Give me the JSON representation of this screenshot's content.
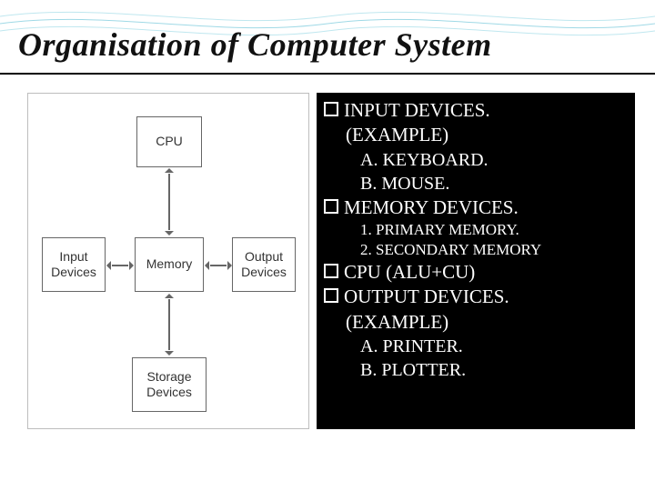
{
  "title": "Organisation of Computer System",
  "diagram": {
    "cpu": "CPU",
    "input": "Input\nDevices",
    "memory": "Memory",
    "output": "Output\nDevices",
    "storage": "Storage\nDevices"
  },
  "list": {
    "l1": "INPUT DEVICES.",
    "l1a": "(EXAMPLE)",
    "l1b": "A. KEYBOARD.",
    "l1c": "B. MOUSE.",
    "l2": "MEMORY DEVICES.",
    "l2a": "1. PRIMARY MEMORY.",
    "l2b": "2. SECONDARY MEMORY",
    "l3": "CPU (ALU+CU)",
    "l4": "OUTPUT DEVICES.",
    "l4a": "(EXAMPLE)",
    "l4b": "A. PRINTER.",
    "l4c": "B. PLOTTER."
  }
}
